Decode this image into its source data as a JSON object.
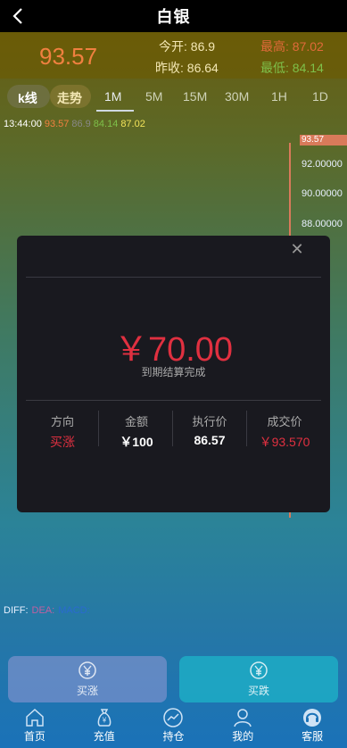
{
  "header": {
    "title": "白银"
  },
  "quote": {
    "price": "93.57",
    "open_label": "今开:",
    "open_value": "86.9",
    "prev_label": "昨收:",
    "prev_value": "86.64",
    "high_label": "最高:",
    "high_value": "87.02",
    "low_label": "最低:",
    "low_value": "84.14"
  },
  "tabs": {
    "items": [
      {
        "label": "k线"
      },
      {
        "label": "走势"
      },
      {
        "label": "1M"
      },
      {
        "label": "5M"
      },
      {
        "label": "15M"
      },
      {
        "label": "30M"
      },
      {
        "label": "1H"
      },
      {
        "label": "1D"
      }
    ]
  },
  "status": {
    "time": "13:44:00",
    "v1": "93.57",
    "v2": "86.9",
    "v3": "84.14",
    "v4": "87.02"
  },
  "chart": {
    "price_tag": "93.57",
    "y_labels": [
      "92.00000",
      "90.00000",
      "88.00000"
    ]
  },
  "indicators": {
    "diff": "DIFF:",
    "dea": "DEA:",
    "macd": "MACD:"
  },
  "actions": {
    "buy_label": "买涨",
    "sell_label": "买跌"
  },
  "nav": {
    "items": [
      {
        "label": "首页",
        "icon": "home-icon"
      },
      {
        "label": "充值",
        "icon": "money-bag-icon"
      },
      {
        "label": "持仓",
        "icon": "chart-icon"
      },
      {
        "label": "我的",
        "icon": "user-icon"
      },
      {
        "label": "客服",
        "icon": "support-icon"
      }
    ]
  },
  "modal": {
    "amount": "￥70.00",
    "subtitle": "到期结算完成",
    "columns": [
      {
        "header": "方向",
        "value": "买涨"
      },
      {
        "header": "金额",
        "value": "￥100"
      },
      {
        "header": "执行价",
        "value": "86.57"
      },
      {
        "header": "成交价",
        "value": "￥93.570"
      }
    ]
  },
  "colors": {
    "red": "#e03040",
    "orange": "#f08040",
    "green": "#7ec04a"
  }
}
